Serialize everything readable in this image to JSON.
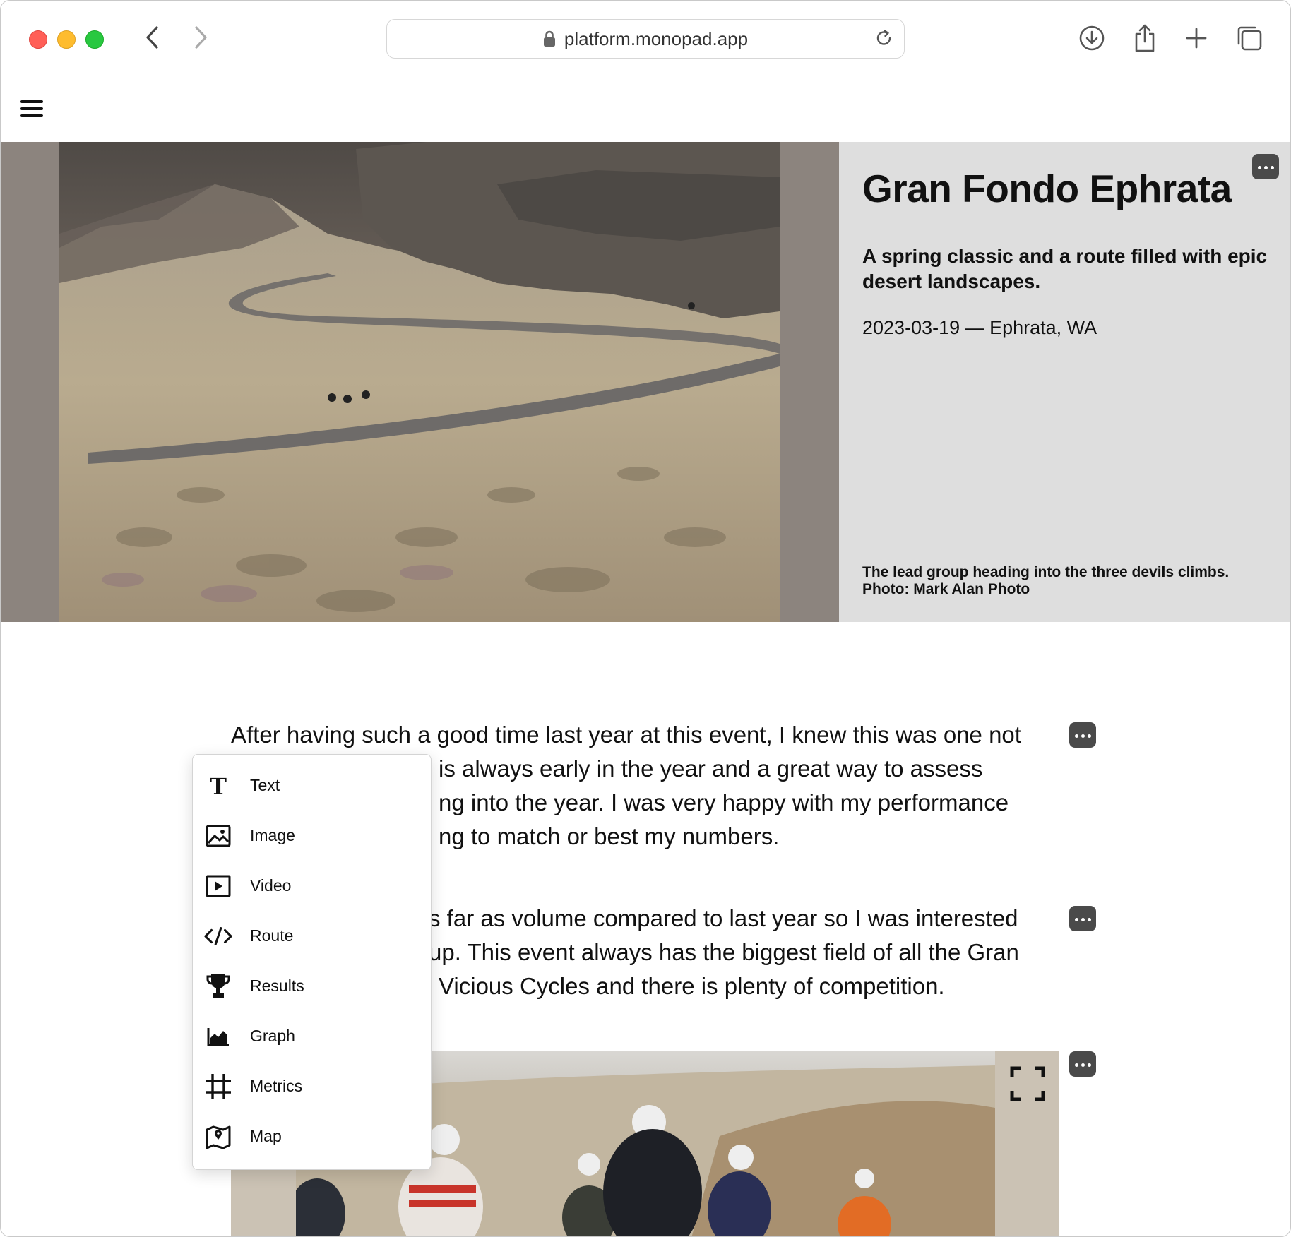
{
  "browser": {
    "url": "platform.monopad.app"
  },
  "hero": {
    "title": "Gran Fondo Ephrata",
    "subtitle": "A spring classic and a route filled with epic desert landscapes.",
    "meta": "2023-03-19 — Ephrata, WA",
    "caption_line1": "The lead group heading into the three devils climbs.",
    "caption_line2": "Photo: Mark Alan Photo"
  },
  "body": {
    "para1": "After having such a good time last year at this event, I knew this was one not",
    "para1_line2": "is always early in the year and a great way to assess",
    "para1_line3": "ng into the year. I was very happy with my performance",
    "para1_line4": "ng to match or best my numbers.",
    "para2_line1": "s far as volume compared to last year so I was interested",
    "para2_line2": "up. This event always has the biggest field of all the Gran",
    "para2_line3": "Vicious Cycles and there is plenty of competition."
  },
  "insert_menu": {
    "items": [
      {
        "label": "Text",
        "icon": "text-icon"
      },
      {
        "label": "Image",
        "icon": "image-icon"
      },
      {
        "label": "Video",
        "icon": "video-icon"
      },
      {
        "label": "Route",
        "icon": "code-icon"
      },
      {
        "label": "Results",
        "icon": "trophy-icon"
      },
      {
        "label": "Graph",
        "icon": "area-chart-icon"
      },
      {
        "label": "Metrics",
        "icon": "grid-icon"
      },
      {
        "label": "Map",
        "icon": "map-icon"
      }
    ]
  },
  "colors": {
    "hero_left_bg": "#8c847e",
    "hero_right_bg": "#dedede",
    "more_button_bg": "#4a4a4a",
    "photo2_frame_bg": "#cbc2b4"
  }
}
